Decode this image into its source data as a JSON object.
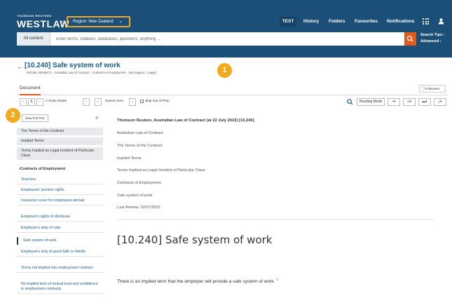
{
  "header": {
    "brand_small": "THOMSON REUTERS",
    "brand_big": "WESTLAW",
    "region_label": "Region: New Zealand",
    "nav": {
      "test": "TEST",
      "history": "History",
      "folders": "Folders",
      "favourites": "Favourites",
      "notifications": "Notifications"
    }
  },
  "search": {
    "scope": "All content",
    "placeholder": "Enter terms, citations, databases, questions, anything ...",
    "tips": "Search Tips",
    "advanced": "Advanced"
  },
  "document": {
    "title": "[10.240] Safe system of work",
    "breadcrumb": "HOCBK.49106472 · Australian Law of Contract · Contracts of Employment · Not (Approx. 1 page)",
    "tab": "Document",
    "fullscreen": "Fullscreen"
  },
  "badges": {
    "one": "1",
    "two": "2"
  },
  "toolbar": {
    "results": "2 of 88 results",
    "search_term": "Search term",
    "skip_out": "Skip Out of Plan",
    "reading_mode": "Reading Mode"
  },
  "sidebar": {
    "view_full_toc": "View Full TOC",
    "items": [
      "The Terms of the Contract",
      "Implied Terms",
      "Terms Implied as Legal Incident of Particular Class",
      "Contracts of Employment",
      "Teachers",
      "Employees' pension rights",
      "Insurance cover for employees abroad",
      "Employer's rights of dismissal",
      "Employee's duty of care",
      "Safe system of work",
      "Employee's duty of good faith or fidelity",
      "Terms not implied into employment contract",
      "No implied term of mutual trust and confidence in employment contracts"
    ]
  },
  "content": {
    "source": "Thomson Reuters, Australian Law of Contract (at 22 July 2022) [10.240]",
    "path": [
      "Australian Law of Contract",
      "The Terms of the Contract",
      "Implied Terms",
      "Terms Implied as Legal Incident of Particular Class",
      "Contracts of Employment",
      "Safe system of work",
      "Last Review: 22/07/2022"
    ],
    "heading": "[10.240] Safe system of work",
    "body": "There is an implied term that the employer will provide a safe system of work.",
    "footnote": "1"
  },
  "colors": {
    "header_bg": "#1b4f78",
    "accent_orange": "#e35a1d",
    "highlight": "#f5a623",
    "link": "#1a5b8c"
  }
}
